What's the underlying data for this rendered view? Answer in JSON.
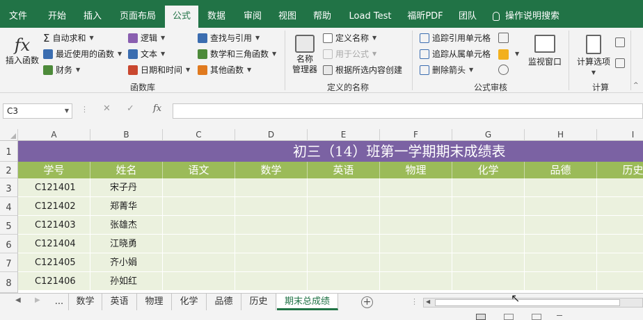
{
  "menubar": {
    "tabs": [
      {
        "label": "文件"
      },
      {
        "label": "开始"
      },
      {
        "label": "插入"
      },
      {
        "label": "页面布局"
      },
      {
        "label": "公式"
      },
      {
        "label": "数据"
      },
      {
        "label": "审阅"
      },
      {
        "label": "视图"
      },
      {
        "label": "帮助"
      },
      {
        "label": "Load Test"
      },
      {
        "label": "福昕PDF"
      },
      {
        "label": "团队"
      }
    ],
    "search_label": "操作说明搜索"
  },
  "ribbon": {
    "function_library": {
      "insert_function": "插入函数",
      "autosum": "自动求和",
      "recent": "最近使用的函数",
      "financial": "财务",
      "logical": "逻辑",
      "text": "文本",
      "datetime": "日期和时间",
      "lookup": "查找与引用",
      "math": "数学和三角函数",
      "more": "其他函数",
      "group_label": "函数库"
    },
    "defined_names": {
      "name_manager_line1": "名称",
      "name_manager_line2": "管理器",
      "define_name": "定义名称",
      "use_in_formula": "用于公式",
      "create_from_selection": "根据所选内容创建",
      "group_label": "定义的名称"
    },
    "formula_auditing": {
      "trace_precedents": "追踪引用单元格",
      "trace_dependents": "追踪从属单元格",
      "remove_arrows": "删除箭头",
      "watch_window": "监视窗口",
      "group_label": "公式审核"
    },
    "calculation": {
      "options": "计算选项",
      "group_label": "计算"
    }
  },
  "formula_bar": {
    "name_box": "C3",
    "fx": "fx",
    "value": ""
  },
  "grid": {
    "columns": [
      "A",
      "B",
      "C",
      "D",
      "E",
      "F",
      "G",
      "H",
      "I"
    ],
    "rows": [
      "1",
      "2",
      "3",
      "4",
      "5",
      "6",
      "7",
      "8"
    ],
    "title": "初三（14）班第一学期期末成绩表",
    "headers": [
      "学号",
      "姓名",
      "语文",
      "数学",
      "英语",
      "物理",
      "化学",
      "品德",
      "历史"
    ],
    "data": [
      [
        "C121401",
        "宋子丹"
      ],
      [
        "C121402",
        "郑菁华"
      ],
      [
        "C121403",
        "张雄杰"
      ],
      [
        "C121404",
        "江晓勇"
      ],
      [
        "C121405",
        "齐小娟"
      ],
      [
        "C121406",
        "孙如红"
      ]
    ]
  },
  "sheets": {
    "ellipsis": "...",
    "tabs": [
      {
        "label": "数学"
      },
      {
        "label": "英语"
      },
      {
        "label": "物理"
      },
      {
        "label": "化学"
      },
      {
        "label": "品德"
      },
      {
        "label": "历史"
      },
      {
        "label": "期末总成绩"
      }
    ],
    "active": "期末总成绩"
  },
  "colors": {
    "brand": "#217346",
    "title_fill": "#7b62a3",
    "header_fill": "#9bbb59",
    "data_fill": "#ebf1de"
  }
}
